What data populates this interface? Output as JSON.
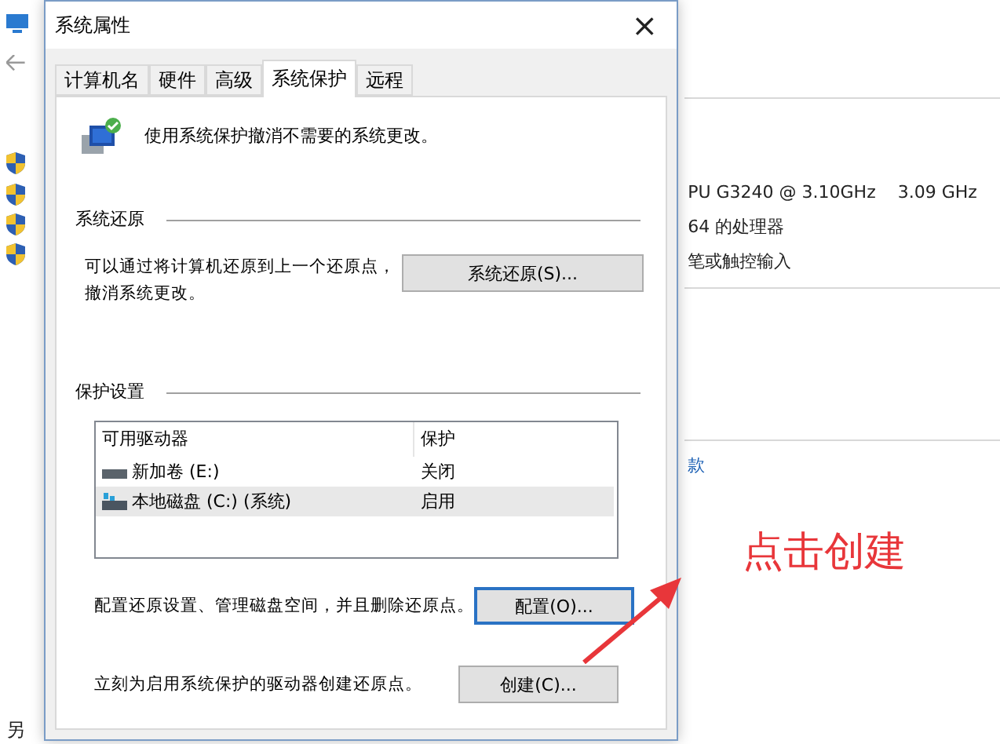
{
  "background_window": {
    "footer": "另",
    "right_lines": [
      {
        "kind": "spec",
        "texts": [
          "PU G3240 @ 3.10GHz",
          "3.09 GHz"
        ]
      },
      {
        "kind": "spec",
        "texts": [
          "64 的处理器"
        ]
      },
      {
        "kind": "spec",
        "texts": [
          "笔或触控输入"
        ]
      },
      {
        "kind": "link",
        "texts": [
          "款"
        ]
      }
    ]
  },
  "dialog": {
    "title": "系统属性",
    "close": "×",
    "tabs": [
      {
        "label": "计算机名",
        "selected": false
      },
      {
        "label": "硬件",
        "selected": false
      },
      {
        "label": "高级",
        "selected": false
      },
      {
        "label": "系统保护",
        "selected": true
      },
      {
        "label": "远程",
        "selected": false
      }
    ],
    "intro": "使用系统保护撤消不需要的系统更改。",
    "restore": {
      "heading": "系统还原",
      "text": "可以通过将计算机还原到上一个还原点，撤消系统更改。",
      "button": {
        "label": "系统还原(S)...",
        "focused": false
      }
    },
    "protection": {
      "heading": "保护设置",
      "columns": [
        "可用驱动器",
        "保护"
      ],
      "drives": [
        {
          "kind": "removable",
          "name": "新加卷 (E:)",
          "protection": "关闭",
          "selected": false
        },
        {
          "kind": "system",
          "name": "本地磁盘 (C:) (系统)",
          "protection": "启用",
          "selected": true
        }
      ],
      "actions": [
        {
          "text": "配置还原设置、管理磁盘空间，并且删除还原点。",
          "button": {
            "label": "配置(O)...",
            "focused": true
          }
        },
        {
          "text": "立刻为启用系统保护的驱动器创建还原点。",
          "button": {
            "label": "创建(C)...",
            "focused": false
          }
        }
      ]
    }
  },
  "annotation": {
    "text": "点击创建"
  }
}
